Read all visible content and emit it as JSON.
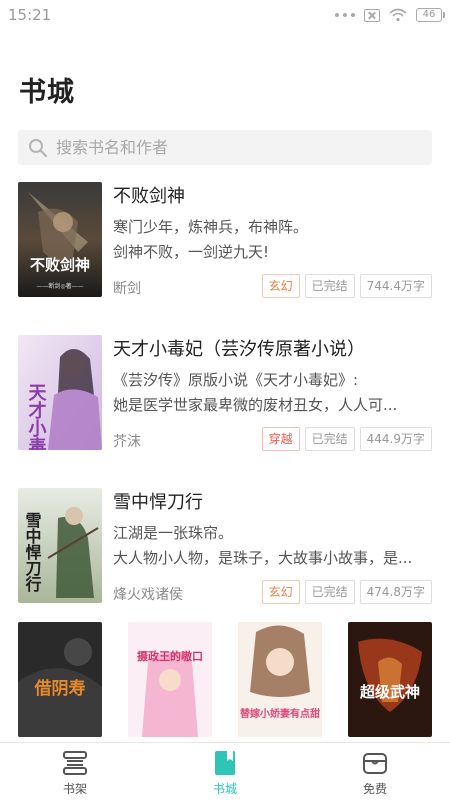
{
  "status_bar": {
    "time": "15:21",
    "battery": "46"
  },
  "header": {
    "title": "书城"
  },
  "search": {
    "placeholder": "搜索书名和作者"
  },
  "books": [
    {
      "title": "不败剑神",
      "desc_line1": "寒门少年，炼神兵，布神阵。",
      "desc_line2": "剑神不败，一剑逆九天!",
      "author": "断剑",
      "genre": "玄幻",
      "status": "已完结",
      "words": "744.4万字",
      "cover_text": "不败剑神",
      "cover_sub": "——断剑◎著——"
    },
    {
      "title": "天才小毒妃（芸汐传原著小说）",
      "desc_line1": "《芸汐传》原版小说《天才小毒妃》:",
      "desc_line2": "她是医学世家最卑微的废材丑女，人人可...",
      "author": "芥沫",
      "genre": "穿越",
      "status": "已完结",
      "words": "444.9万字",
      "cover_text": "天才小毒妃"
    },
    {
      "title": "雪中悍刀行",
      "desc_line1": "江湖是一张珠帘。",
      "desc_line2": "大人物小人物，是珠子，大故事小故事，是...",
      "author": "烽火戏诸侯",
      "genre": "玄幻",
      "status": "已完结",
      "words": "474.8万字",
      "cover_text": "雪中悍刀行"
    }
  ],
  "cover_row": [
    {
      "text": "借阴寿"
    },
    {
      "text": "摄政王的嗷口"
    },
    {
      "text": "替嫁小娇妻有点甜"
    },
    {
      "text": "超级武神"
    }
  ],
  "nav": {
    "items": [
      {
        "label": "书架"
      },
      {
        "label": "书城"
      },
      {
        "label": "免费"
      }
    ]
  },
  "colors": {
    "accent": "#2ec4b6",
    "genre_orange": "#f07b3f",
    "genre_red": "#f05a4c"
  }
}
